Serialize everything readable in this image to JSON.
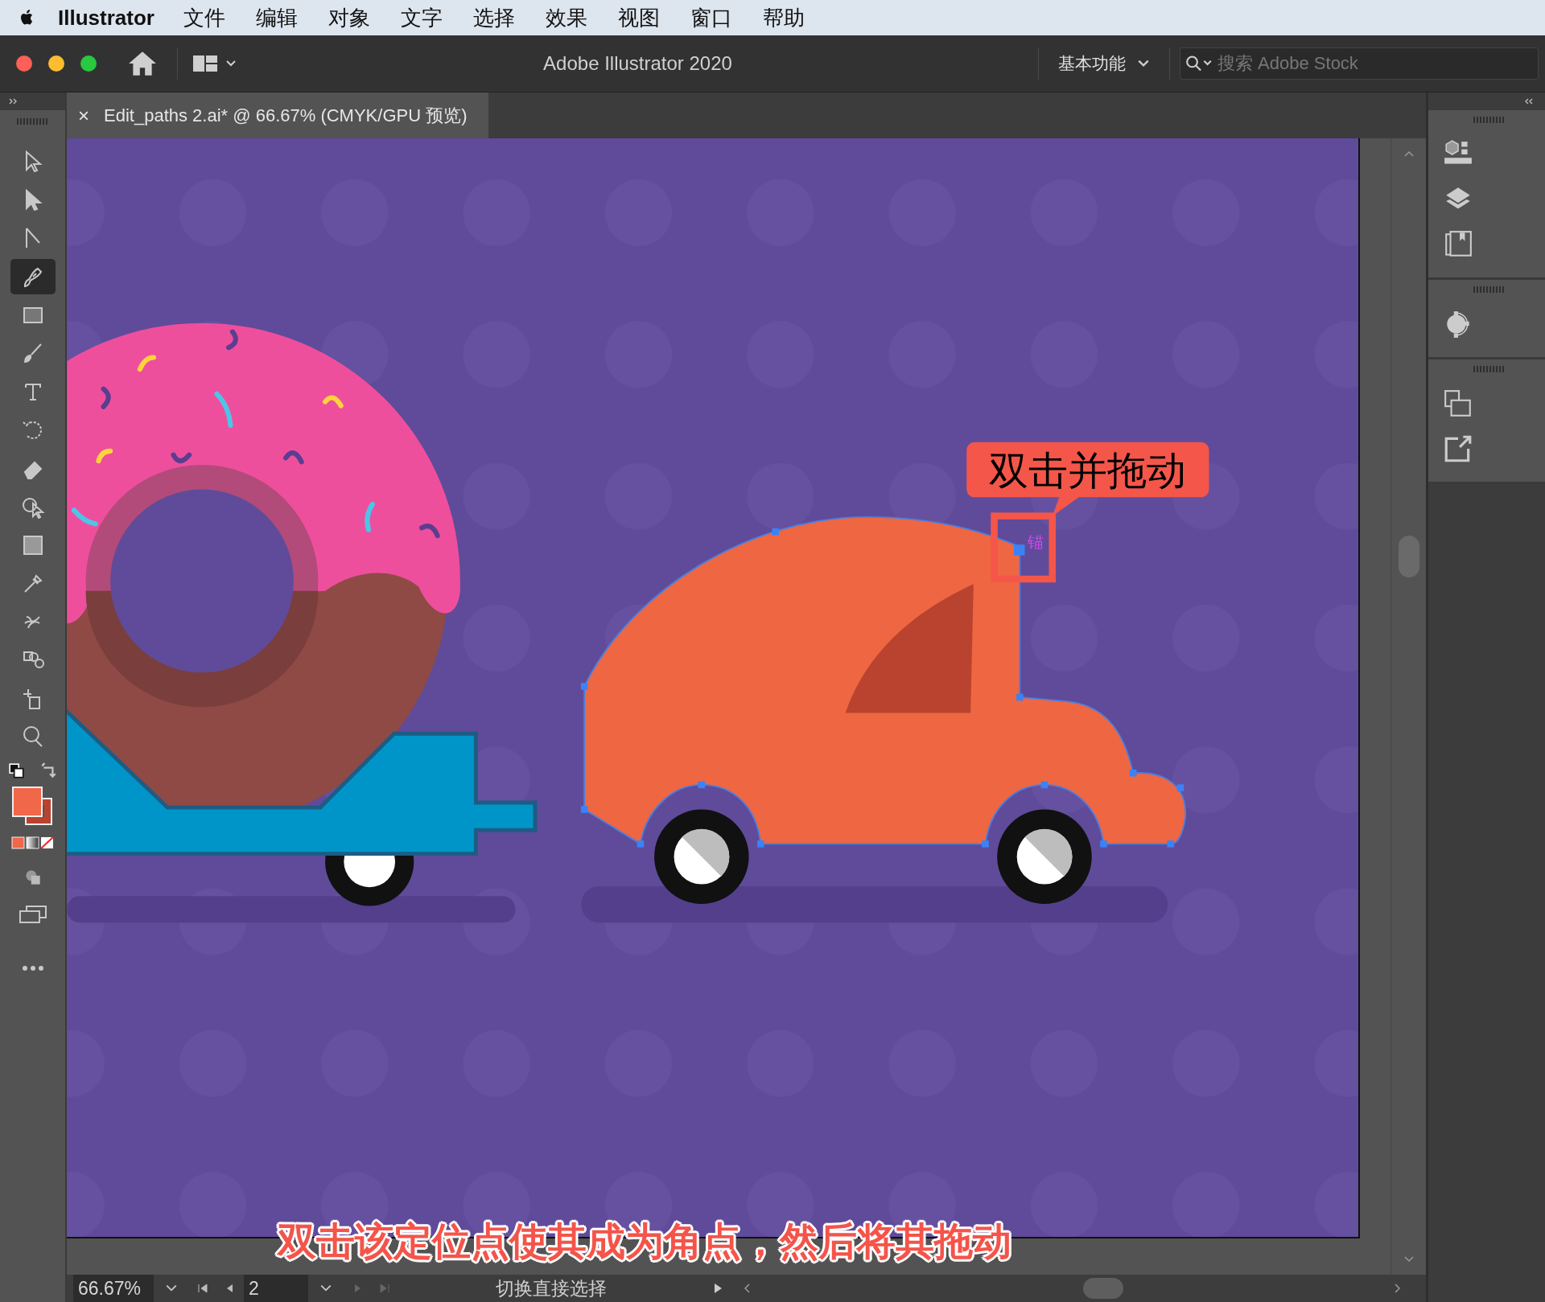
{
  "menu_bar": {
    "app_name": "Illustrator",
    "items": [
      "文件",
      "编辑",
      "对象",
      "文字",
      "选择",
      "效果",
      "视图",
      "窗口",
      "帮助"
    ]
  },
  "title_bar": {
    "title": "Adobe Illustrator 2020",
    "workspace": "基本功能",
    "search": {
      "placeholder": "搜索 Adobe Stock"
    }
  },
  "document_tab": {
    "close": "×",
    "title": "Edit_paths 2.ai* @ 66.67% (CMYK/GPU 预览)"
  },
  "tools": [
    {
      "kind": "selection",
      "selected": false
    },
    {
      "kind": "direct-selection",
      "selected": false
    },
    {
      "kind": "line",
      "selected": false
    },
    {
      "kind": "pen",
      "selected": true
    },
    {
      "kind": "rectangle",
      "selected": false
    },
    {
      "kind": "paintbrush",
      "selected": false
    },
    {
      "kind": "type",
      "selected": false
    },
    {
      "kind": "rotate",
      "selected": false
    },
    {
      "kind": "eraser",
      "selected": false
    },
    {
      "kind": "shape-builder",
      "selected": false
    },
    {
      "kind": "gradient",
      "selected": false
    },
    {
      "kind": "eyedropper",
      "selected": false
    },
    {
      "kind": "puppet-warp",
      "selected": false
    },
    {
      "kind": "blend",
      "selected": false
    },
    {
      "kind": "artboard",
      "selected": false
    },
    {
      "kind": "zoom",
      "selected": false
    }
  ],
  "canvas": {
    "callout": "双击并拖动",
    "anchor_label": "锚",
    "caption": "双击该定位点使其成为角点，然后将其拖动"
  },
  "status_bar": {
    "zoom": "66.67%",
    "artboard": "2",
    "tool_hint": "切换直接选择"
  }
}
